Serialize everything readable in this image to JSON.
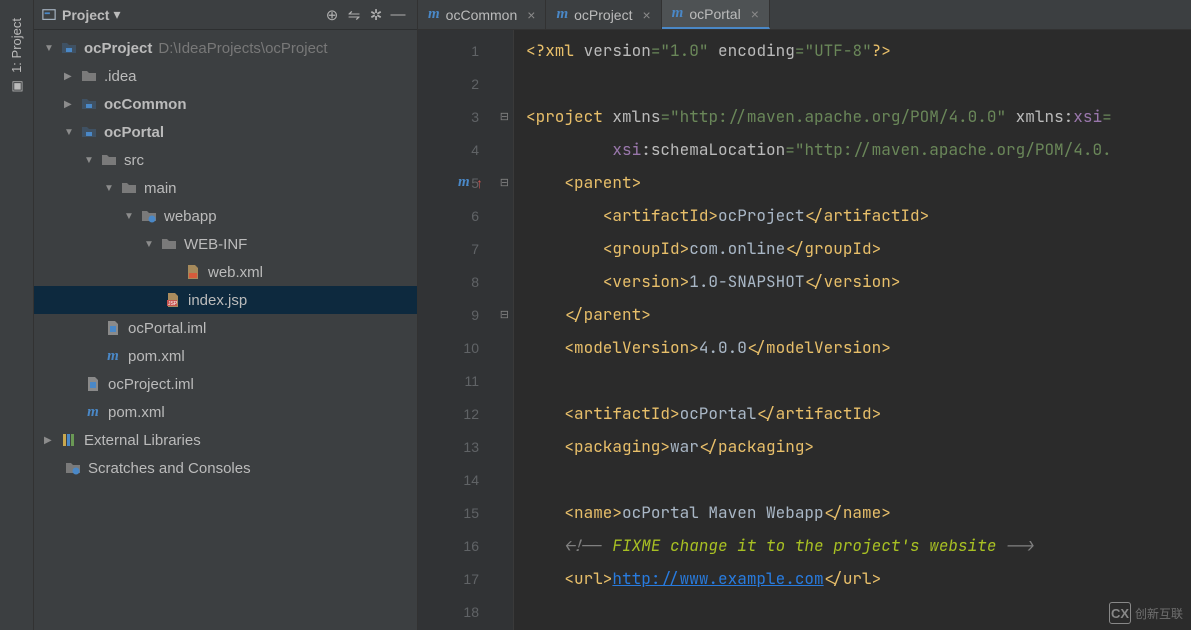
{
  "vertical_tab": {
    "label": "1: Project"
  },
  "project_panel": {
    "title": "Project",
    "root": {
      "name": "ocProject",
      "path": "D:\\IdeaProjects\\ocProject",
      "idea": ".idea",
      "ocCommon": "ocCommon",
      "ocPortal": "ocPortal",
      "src": "src",
      "main": "main",
      "webapp": "webapp",
      "webinf": "WEB-INF",
      "webxml": "web.xml",
      "indexjsp": "index.jsp",
      "ocPortal_iml": "ocPortal.iml",
      "pom1": "pom.xml",
      "ocProject_iml": "ocProject.iml",
      "pom2": "pom.xml",
      "ext_lib": "External Libraries",
      "scratches": "Scratches and Consoles"
    }
  },
  "tabs": [
    {
      "label": "ocCommon"
    },
    {
      "label": "ocProject"
    },
    {
      "label": "ocPortal"
    }
  ],
  "code": {
    "xml_decl_prefix": "<?",
    "xml": "xml ",
    "version_attr": "version",
    "version_val": "\"1.0\"",
    "encoding_attr": "encoding",
    "encoding_val": "\"UTF-8\"",
    "xml_decl_suffix": "?>",
    "proj_tag_open": "<",
    "project": "project ",
    "xmlns": "xmlns",
    "maven_url": "\"http://maven.apache.org/POM/4.0.0\"",
    "xmlns_xsi": "xmlns:xsi",
    "xsi": "xsi",
    "colon": ":",
    "schemaLocation": "schemaLocation",
    "schema_val": "\"http://maven.apache.org/POM/4.0.",
    "parent_open": "<parent>",
    "artifactId_open": "<artifactId>",
    "artifactId_close": "</artifactId>",
    "ocProject_txt": "ocProject",
    "groupId_open": "<groupId>",
    "groupId_close": "</groupId>",
    "com_online": "com.online",
    "version_open": "<version>",
    "version_close": "</version>",
    "snapshot": "1.0-SNAPSHOT",
    "parent_close": "</parent>",
    "modelVersion_open": "<modelVersion>",
    "modelVersion_close": "</modelVersion>",
    "mv_val": "4.0.0",
    "ocPortal_txt": "ocPortal",
    "packaging_open": "<packaging>",
    "packaging_close": "</packaging>",
    "war": "war",
    "name_open": "<name>",
    "name_close": "</name>",
    "name_val": "ocPortal Maven Webapp",
    "comment_open": "<!-- ",
    "fixme": "FIXME change it to the project's website",
    "comment_close": " -->",
    "url_open": "<url>",
    "url_close": "</url>",
    "url_val": "http://www.example.com"
  },
  "watermark": {
    "logo": "CX",
    "text": "创新互联"
  }
}
